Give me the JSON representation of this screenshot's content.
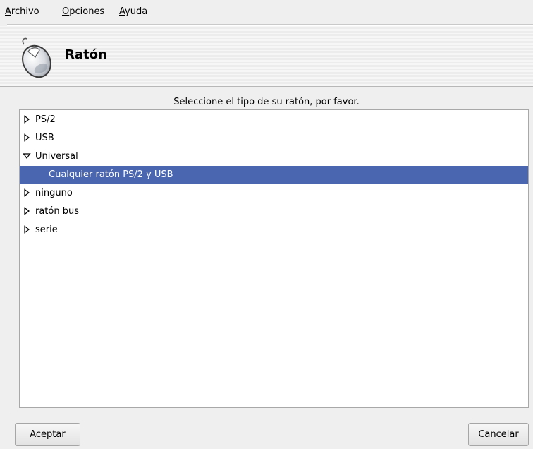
{
  "menubar": {
    "items": [
      {
        "mnemonic": "A",
        "rest": "rchivo"
      },
      {
        "mnemonic": "O",
        "rest": "pciones"
      },
      {
        "mnemonic": "A",
        "rest": "yuda"
      }
    ]
  },
  "header": {
    "icon": "mouse-icon",
    "title": "Ratón"
  },
  "main": {
    "prompt": "Seleccione el tipo de su ratón, por favor.",
    "tree": [
      {
        "label": "PS/2",
        "expanded": false
      },
      {
        "label": "USB",
        "expanded": false
      },
      {
        "label": "Universal",
        "expanded": true
      },
      {
        "label": "Cualquier ratón PS/2 y USB",
        "child": true,
        "selected": true
      },
      {
        "label": "ninguno",
        "expanded": false
      },
      {
        "label": "ratón bus",
        "expanded": false
      },
      {
        "label": "serie",
        "expanded": false
      }
    ]
  },
  "footer": {
    "ok_label": "Aceptar",
    "cancel_label": "Cancelar"
  },
  "colors": {
    "selection": "#4a66b1",
    "background": "#efefef"
  }
}
